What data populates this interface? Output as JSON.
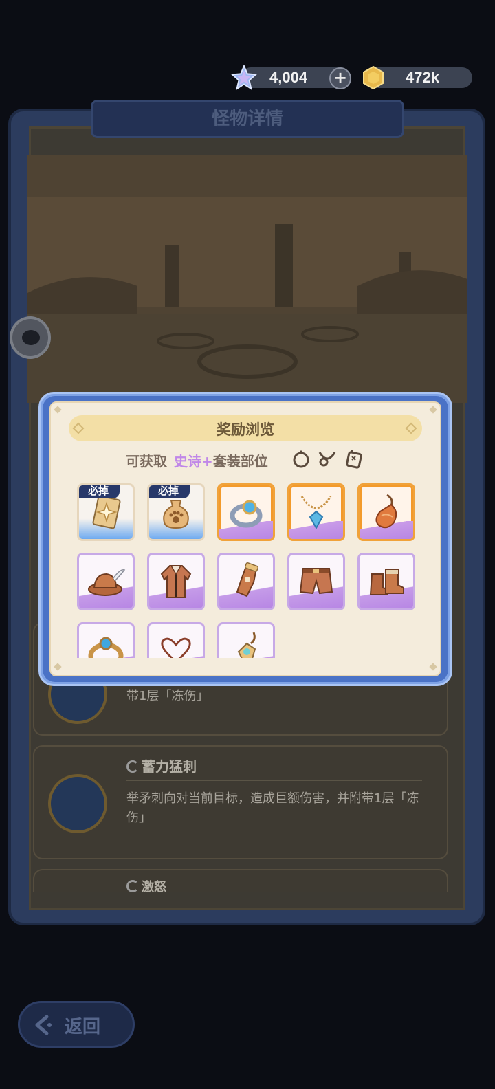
{
  "currency": {
    "gems": "4,004",
    "coins": "472k"
  },
  "panel": {
    "title": "怪物详情"
  },
  "skills": [
    {
      "desc_tail": "带1层「冻伤」"
    },
    {
      "name": "蓄力猛刺",
      "desc": "举矛刺向对当前目标，造成巨额伤害，并附带1层「冻伤」"
    },
    {
      "name": "激怒"
    }
  ],
  "modal": {
    "title": "奖励浏览",
    "subtitle_prefix": "可获取",
    "subtitle_epic": "史诗+",
    "subtitle_suffix": "套装部位",
    "slot_icons": [
      "ring-slot-icon",
      "necklace-slot-icon",
      "talisman-slot-icon"
    ],
    "must_drop_label": "必掉",
    "items": [
      {
        "name": "skill-card-icon",
        "rarity": "blue",
        "must_drop": true
      },
      {
        "name": "paw-bag-icon",
        "rarity": "blue",
        "must_drop": true
      },
      {
        "name": "gem-ring-icon",
        "rarity": "orange"
      },
      {
        "name": "gem-necklace-icon",
        "rarity": "orange"
      },
      {
        "name": "conch-pendant-icon",
        "rarity": "orange"
      },
      {
        "name": "feather-hat-icon",
        "rarity": "purple"
      },
      {
        "name": "jacket-icon",
        "rarity": "purple"
      },
      {
        "name": "gauntlet-icon",
        "rarity": "purple"
      },
      {
        "name": "shorts-icon",
        "rarity": "purple"
      },
      {
        "name": "boots-icon",
        "rarity": "purple"
      },
      {
        "name": "gem-ring-icon",
        "rarity": "purple"
      },
      {
        "name": "heart-necklace-icon",
        "rarity": "purple"
      },
      {
        "name": "amulet-icon",
        "rarity": "purple"
      }
    ]
  },
  "back_button": {
    "label": "返回"
  }
}
